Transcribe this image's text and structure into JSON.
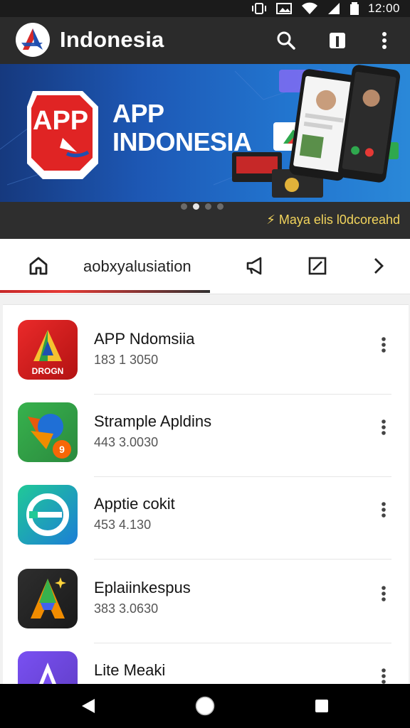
{
  "status_bar": {
    "time": "12:00",
    "icons": [
      "vibrate-icon",
      "image-icon",
      "wifi-icon",
      "signal-icon",
      "battery-icon"
    ]
  },
  "app_bar": {
    "title": "Indonesia",
    "actions": [
      "search-icon",
      "bookmark-icon",
      "more-vert-icon"
    ]
  },
  "banner": {
    "badge_text": "APP",
    "title_line1": "APP",
    "title_line2": "INDONESIA",
    "caption": "⚡ Maya elis l0dcoreahd",
    "slides": 4,
    "active_slide": 2
  },
  "tabs": {
    "active_label": "aobxyalusiation",
    "icons": [
      "home-icon",
      "megaphone-icon",
      "edit-box-icon",
      "chevron-right-icon"
    ]
  },
  "apps": [
    {
      "name": "APP Ndomsiia",
      "meta": "183 1 3050",
      "icon": "app-red-icon",
      "color": "#d82020",
      "badge": "DROGN"
    },
    {
      "name": "Strample Apldins",
      "meta": "443 3.0030",
      "icon": "app-green-icon",
      "color": "#3aa845",
      "badge": "9"
    },
    {
      "name": "Apptie cokit",
      "meta": "453 4.130",
      "icon": "app-teal-icon",
      "color": "#26c2a0",
      "badge": ""
    },
    {
      "name": "Eplaiinkespus",
      "meta": "383 3.0630",
      "icon": "app-dark-icon",
      "color": "#2a2a2a",
      "badge": ""
    },
    {
      "name": "Lite Meaki",
      "meta": "",
      "icon": "app-purple-icon",
      "color": "#6b4fe0",
      "badge": ""
    }
  ],
  "colors": {
    "app_bar": "#2b2b2b",
    "banner_blue": "#1d58b5",
    "accent_red": "#e53935",
    "caption_yellow": "#f2d45c"
  },
  "nav_bar": {
    "buttons": [
      "back-icon",
      "home-circle-icon",
      "recents-icon"
    ]
  }
}
